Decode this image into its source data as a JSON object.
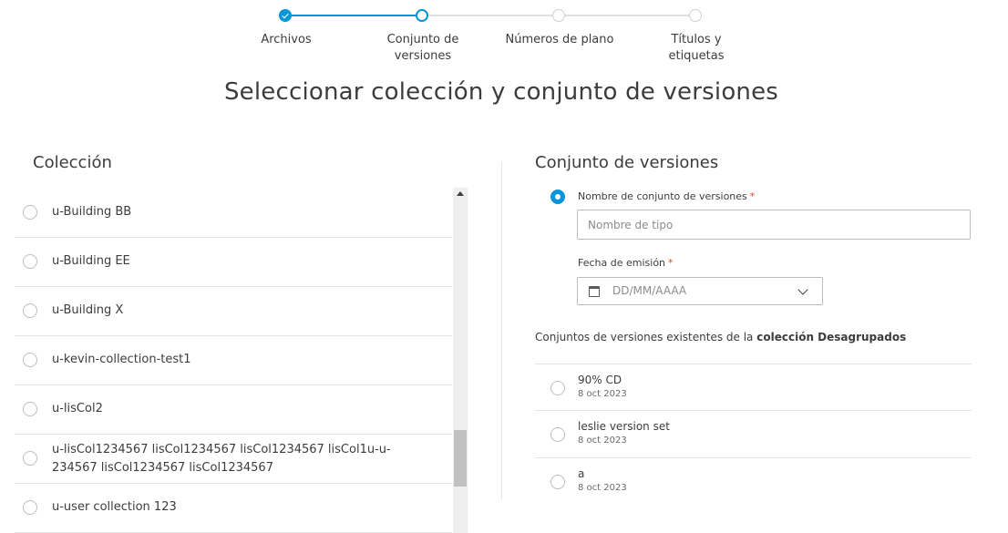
{
  "stepper": {
    "steps": [
      {
        "label": "Archivos",
        "state": "done"
      },
      {
        "label": "Conjunto de versiones",
        "state": "active"
      },
      {
        "label": "Números de plano",
        "state": "pending"
      },
      {
        "label": "Títulos y etiquetas",
        "state": "pending"
      }
    ],
    "accent": "#0696d7"
  },
  "page": {
    "title": "Seleccionar colección y conjunto de versiones"
  },
  "collection": {
    "heading": "Colección",
    "items": [
      {
        "label": "u-Building BB"
      },
      {
        "label": "u-Building EE"
      },
      {
        "label": "u-Building X"
      },
      {
        "label": "u-kevin-collection-test1"
      },
      {
        "label": "u-lisCol2"
      },
      {
        "label": "u-lisCol1234567 lisCol1234567 lisCol1234567 lisCol1u-u-234567 lisCol1234567 lisCol1234567"
      },
      {
        "label": "u-user collection 123"
      }
    ]
  },
  "version_set": {
    "heading": "Conjunto de versiones",
    "name_label": "Nombre de conjunto de versiones",
    "required_mark": "*",
    "name_placeholder": "Nombre de tipo",
    "date_label": "Fecha de emisión",
    "date_placeholder": "DD/MM/AAAA",
    "existing_prefix": "Conjuntos de versiones existentes de la",
    "existing_collection": "colección Desagrupados",
    "existing": [
      {
        "name": "90% CD",
        "date": "8 oct 2023"
      },
      {
        "name": "leslie version set",
        "date": "8 oct 2023"
      },
      {
        "name": "a",
        "date": "8 oct 2023"
      }
    ]
  }
}
